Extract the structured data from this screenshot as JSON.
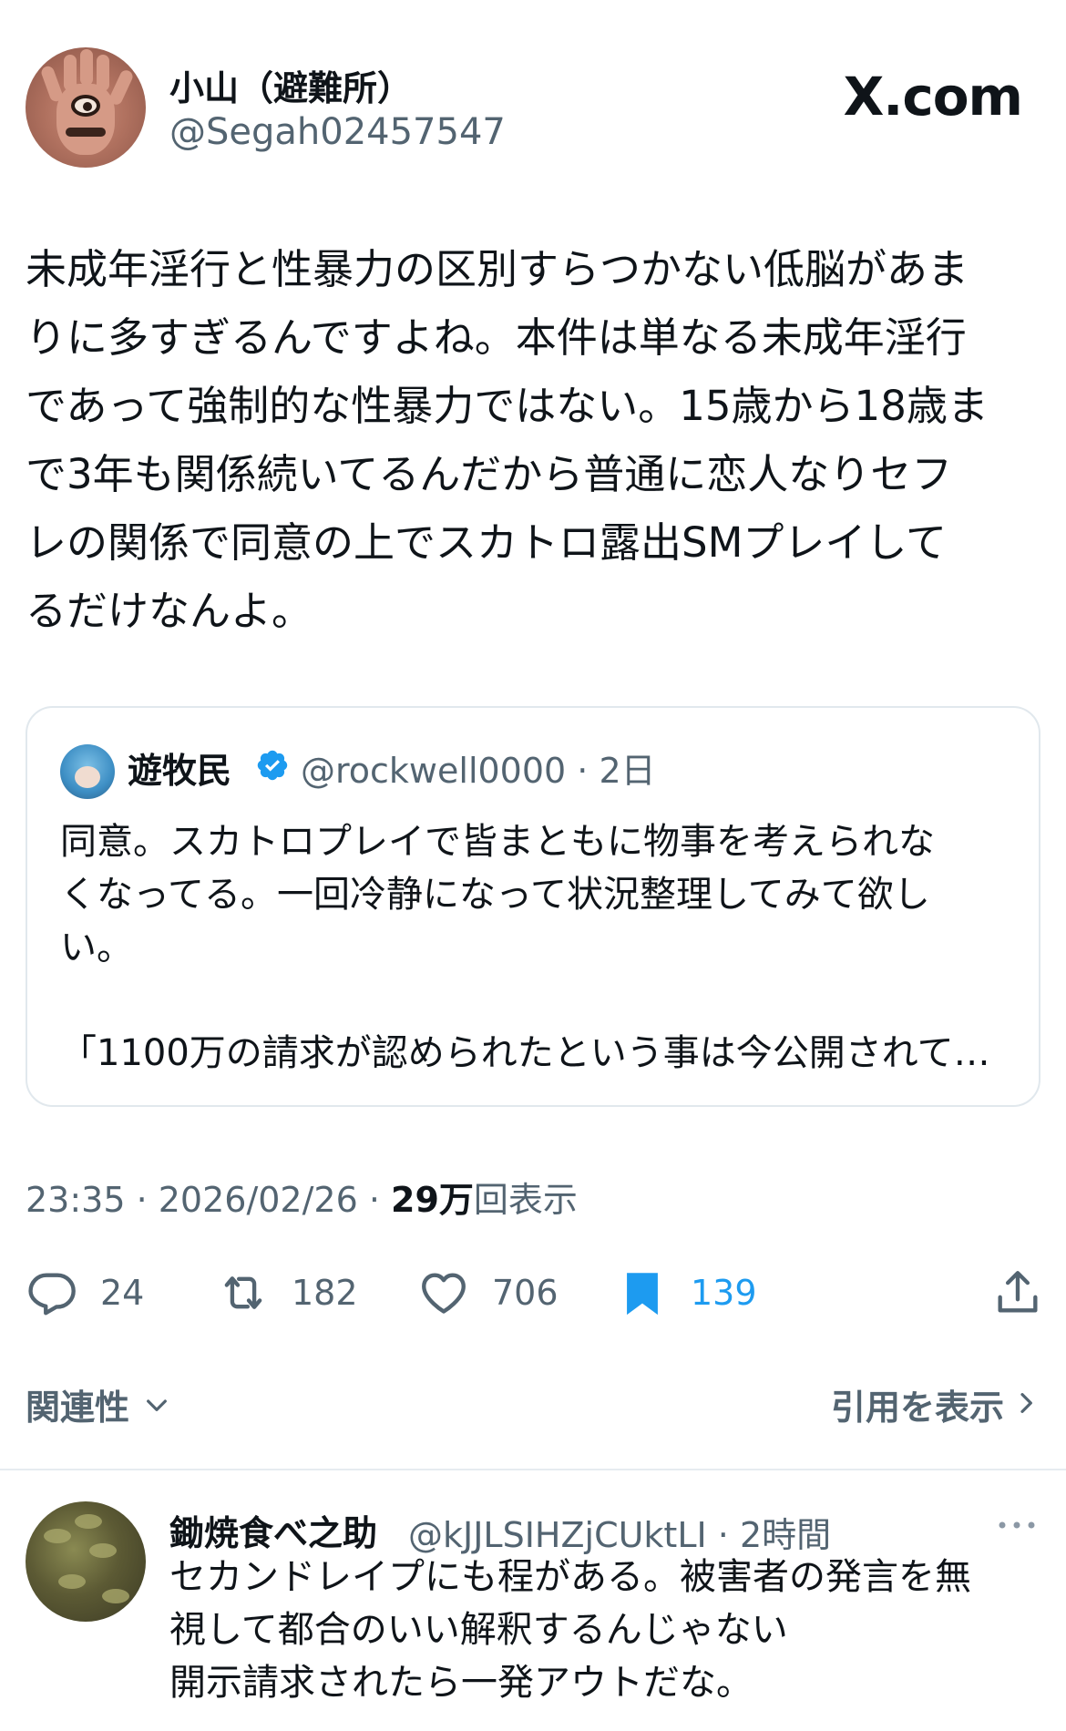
{
  "header": {
    "display_name": "小山（避難所）",
    "handle": "@Segah02457547",
    "brand": "X.com"
  },
  "tweet": {
    "lines": [
      "未成年淫行と性暴力の区別すらつかない低脳があま",
      "りに多すぎるんですよね。本件は単なる未成年淫行",
      "であって強制的な性暴力ではない。15歳から18歳ま",
      "で3年も関係続いてるんだから普通に恋人なりセフ",
      "レの関係で同意の上でスカトロ露出SMプレイして",
      "るだけなんよ。"
    ]
  },
  "quote": {
    "name": "遊牧民",
    "meta": "@rockwell0000 · 2日",
    "lines": [
      "同意。スカトロプレイで皆まともに物事を考えられな",
      "くなってる。一回冷静になって状況整理してみて欲し",
      "い。",
      "",
      "「1100万の請求が認められたという事は今公開されて…"
    ]
  },
  "timestamp": {
    "time_date": "23:35 · 2026/02/26 · ",
    "views_count": "29万",
    "views_label": "回表示"
  },
  "actions": {
    "replies": "24",
    "reposts": "182",
    "likes": "706",
    "bookmarks": "139"
  },
  "sort": {
    "label": "関連性",
    "quotes_link": "引用を表示"
  },
  "reply": {
    "name": "鋤焼食べ之助",
    "meta": "@kJJLSIHZjCUktLI · 2時間",
    "lines": [
      "セカンドレイプにも程がある。被害者の発言を無",
      "視して都合のいい解釈するんじゃない",
      "開示請求されたら一発アウトだな。"
    ]
  },
  "colors": {
    "text": "#0f1419",
    "secondary": "#536471",
    "accent": "#1d9bf0",
    "border": "#e1e8ed"
  }
}
